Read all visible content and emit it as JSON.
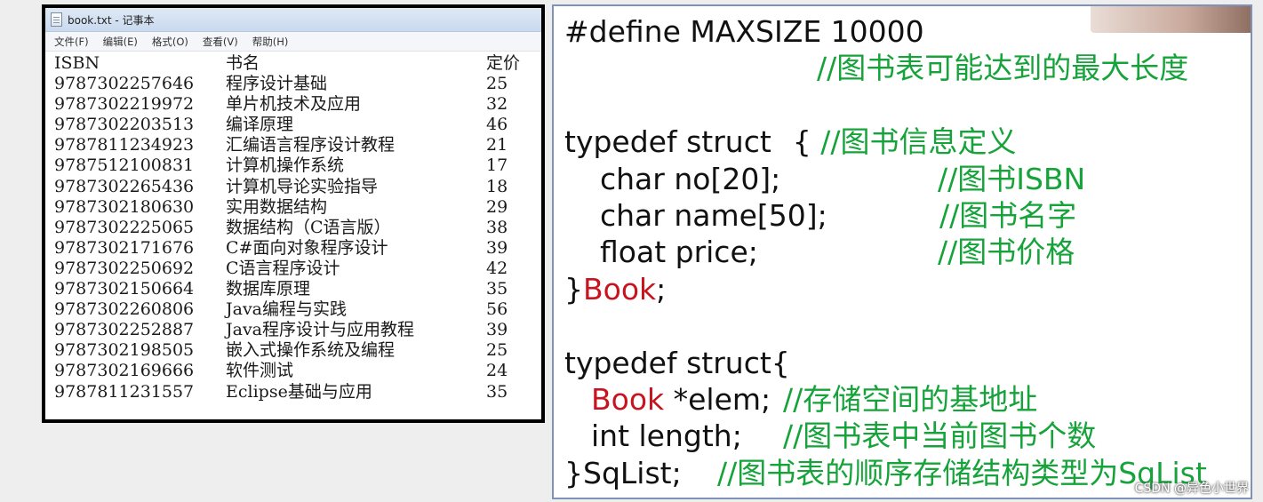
{
  "notepad": {
    "title": "book.txt - 记事本",
    "menus": [
      "文件(F)",
      "编辑(E)",
      "格式(O)",
      "查看(V)",
      "帮助(H)"
    ],
    "header": {
      "isbn": "ISBN",
      "name": "书名",
      "price": "定价"
    },
    "rows": [
      {
        "isbn": "9787302257646",
        "name": "程序设计基础",
        "price": "25"
      },
      {
        "isbn": "9787302219972",
        "name": "单片机技术及应用",
        "price": "32"
      },
      {
        "isbn": "9787302203513",
        "name": "编译原理",
        "price": "46"
      },
      {
        "isbn": "9787811234923",
        "name": "汇编语言程序设计教程",
        "price": "21"
      },
      {
        "isbn": "9787512100831",
        "name": "计算机操作系统",
        "price": "17"
      },
      {
        "isbn": "9787302265436",
        "name": "计算机导论实验指导",
        "price": "18"
      },
      {
        "isbn": "9787302180630",
        "name": "实用数据结构",
        "price": "29"
      },
      {
        "isbn": "9787302225065",
        "name": "数据结构（C语言版）",
        "price": "38"
      },
      {
        "isbn": "9787302171676",
        "name": "C#面向对象程序设计",
        "price": "39"
      },
      {
        "isbn": "9787302250692",
        "name": "C语言程序设计",
        "price": "42"
      },
      {
        "isbn": "9787302150664",
        "name": "数据库原理",
        "price": "35"
      },
      {
        "isbn": "9787302260806",
        "name": "Java编程与实践",
        "price": "56"
      },
      {
        "isbn": "9787302252887",
        "name": "Java程序设计与应用教程",
        "price": "39"
      },
      {
        "isbn": "9787302198505",
        "name": "嵌入式操作系统及编程",
        "price": "25"
      },
      {
        "isbn": "9787302169666",
        "name": "软件测试",
        "price": "24"
      },
      {
        "isbn": "9787811231557",
        "name": "Eclipse基础与应用",
        "price": "35"
      }
    ]
  },
  "code": {
    "define": "#define MAXSIZE 10000",
    "define_comment": "//图书表可能达到的最大长度",
    "struct1_open": "typedef struct",
    "struct1_brace": "{ ",
    "struct1_comment": "//图书信息定义",
    "field_no": "char no[20];",
    "field_no_comment": "//图书ISBN",
    "field_name": "char name[50];",
    "field_name_comment": "//图书名字",
    "field_price": "float price;",
    "field_price_comment": "//图书价格",
    "struct1_close": "}",
    "struct1_typename": "Book",
    "struct1_semicolon": ";",
    "struct2_open": "typedef struct{",
    "elem_type": "Book",
    "elem_decl": " *elem;",
    "elem_comment": "//存储空间的基地址",
    "length_decl": "int length;",
    "length_comment": "//图书表中当前图书个数",
    "struct2_close": "}SqList;",
    "struct2_comment": "//图书表的顺序存储结构类型为SqList"
  },
  "watermark": "CSDN @异色小世界",
  "colors": {
    "comment": "#15a33a",
    "type_name": "#c8141e",
    "slide_border": "#7f93b8"
  }
}
